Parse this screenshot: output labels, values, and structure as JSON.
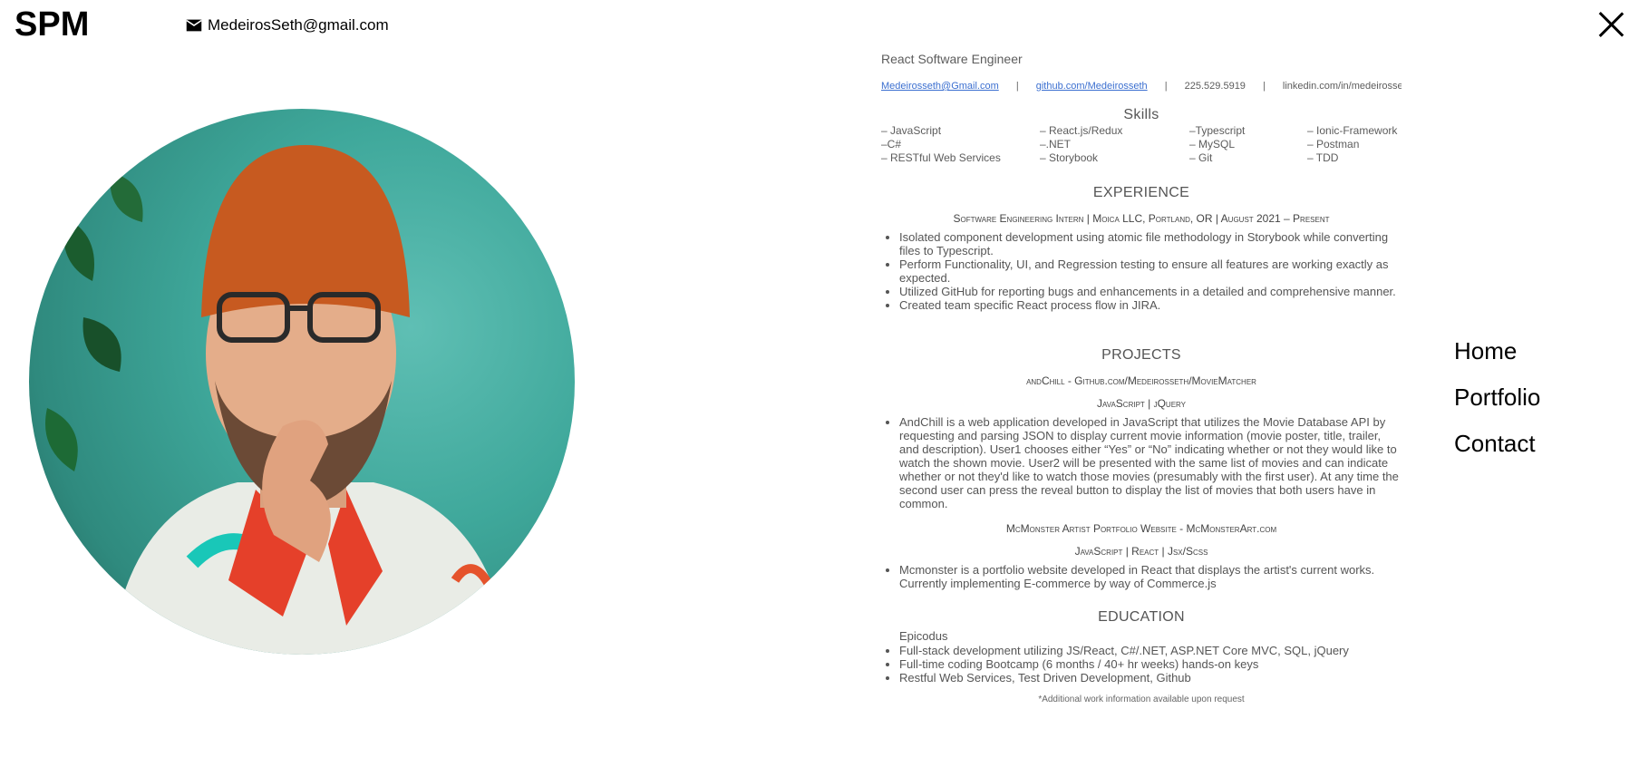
{
  "header": {
    "logo": "SPM",
    "email": "MedeirosSeth@gmail.com",
    "icons": {
      "mail": "mail-icon",
      "close": "close-icon"
    }
  },
  "profile": {
    "image": "portrait-photo"
  },
  "resume": {
    "role": "React Software Engineer",
    "contact": {
      "email": "Medeirosseth@Gmail.com",
      "github": "github.com/Medeirosseth",
      "phone": "225.529.5919",
      "linkedin": "linkedin.com/in/medeirosseth",
      "separator": "|"
    },
    "skills_title": "Skills",
    "skills": [
      [
        "– JavaScript",
        "– React.js/Redux",
        "–Typescript",
        "– Ionic-Framework"
      ],
      [
        "–C#",
        "–.NET",
        "– MySQL",
        "–  Postman"
      ],
      [
        "– RESTful Web Services",
        "– Storybook",
        "– Git",
        "– TDD"
      ]
    ],
    "experience_title": "EXPERIENCE",
    "experience_job": "Software Engineering Intern | Moica LLC,  Portland, OR | August  2021 – Present",
    "experience_bullets": [
      "Isolated component development using atomic file methodology in Storybook while converting files to Typescript.",
      "Perform Functionality, UI, and Regression testing to ensure all features are working exactly as expected.",
      "Utilized GitHub for reporting bugs and enhancements in a detailed and comprehensive manner.",
      "Created team specific React process flow in JIRA."
    ],
    "projects_title": "PROJECTS",
    "project1_title": "andChill - Github.com/Medeirosseth/MovieMatcher",
    "project1_tech": "JavaScript | jQuery",
    "project1_bullet": "AndChill is a web application developed in JavaScript that utilizes the Movie Database API by requesting and parsing JSON to display current movie information (movie poster, title, trailer, and description). User1 chooses either “Yes” or “No”  indicating whether or not they would like to watch the shown movie. User2 will be presented with the same list of movies and can indicate whether or not they'd like to watch those movies (presumably with the first user). At any time the second user can press the reveal button to display the list of movies that both users have in common.",
    "project2_title": "McMonster Artist Portfolio Website - McMonsterArt.com",
    "project2_tech": "JavaScript | React  | Jsx/Scss",
    "project2_bullet": "Mcmonster is a portfolio website developed in React that displays the artist's current works. Currently implementing E-commerce by way of Commerce.js",
    "education_title": "EDUCATION",
    "education_school": "Epicodus",
    "education_bullets": [
      "Full-stack development utilizing JS/React, C#/.NET, ASP.NET Core MVC, SQL, jQuery",
      "Full-time coding Bootcamp (6 months / 40+ hr weeks) hands-on keys",
      "Restful Web Services, Test Driven Development, Github"
    ],
    "footnote": "*Additional work information available upon request"
  },
  "nav": {
    "home": "Home",
    "portfolio": "Portfolio",
    "contact": "Contact"
  }
}
